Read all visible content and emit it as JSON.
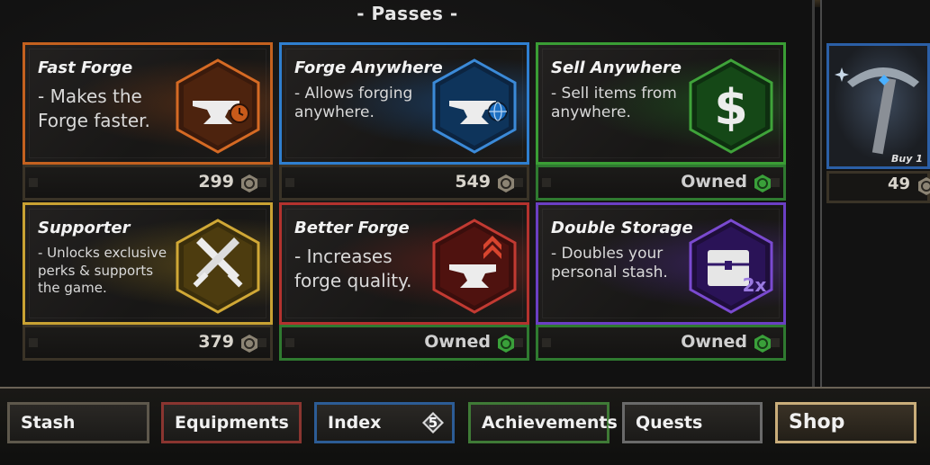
{
  "header": {
    "title": "- Passes -"
  },
  "passes": [
    {
      "name": "Fast Forge",
      "desc": "- Makes the\nForge faster.",
      "price": "299",
      "owned": false,
      "border": "#c4611f",
      "glow": "rgba(180,80,20,0.35)",
      "icon": "anvil-clock-icon"
    },
    {
      "name": "Forge Anywhere",
      "desc": "- Allows forging\nanywhere.",
      "price": "549",
      "owned": false,
      "border": "#2f7fd0",
      "glow": "rgba(30,110,200,0.4)",
      "icon": "anvil-globe-icon"
    },
    {
      "name": "Sell Anywhere",
      "desc": "- Sell items from\nanywhere.",
      "price": "Owned",
      "owned": true,
      "border": "#3a9d35",
      "glow": "rgba(40,150,40,0.35)",
      "icon": "dollar-icon"
    },
    {
      "name": "Supporter",
      "desc": "- Unlocks exclusive\nperks & supports\nthe game.",
      "price": "379",
      "owned": false,
      "border": "#c9a233",
      "glow": "rgba(190,150,30,0.35)",
      "icon": "crossed-swords-icon"
    },
    {
      "name": "Better Forge",
      "desc": "- Increases\nforge quality.",
      "price": "Owned",
      "owned": true,
      "border": "#b3322e",
      "glow": "rgba(170,40,30,0.4)",
      "icon": "anvil-upgrade-icon"
    },
    {
      "name": "Double Storage",
      "desc": "- Doubles your\npersonal stash.",
      "price": "Owned",
      "owned": true,
      "border": "#6b3fc4",
      "glow": "rgba(100,50,190,0.4)",
      "icon": "chest-2x-icon"
    }
  ],
  "side_item": {
    "label": "Buy 1",
    "price": "49",
    "icon": "pickaxe-icon"
  },
  "nav": [
    {
      "label": "Stash",
      "border": "#5e584c"
    },
    {
      "label": "Equipments",
      "border": "#8a3530"
    },
    {
      "label": "Index",
      "border": "#2c5c95",
      "badge": "5"
    },
    {
      "label": "Achievements",
      "border": "#3f7a36"
    },
    {
      "label": "Quests",
      "border": "#6a6a6a"
    },
    {
      "label": "Shop",
      "border": "#c9ad7a",
      "active": true
    }
  ],
  "icon_texts": {
    "double": "2x"
  }
}
